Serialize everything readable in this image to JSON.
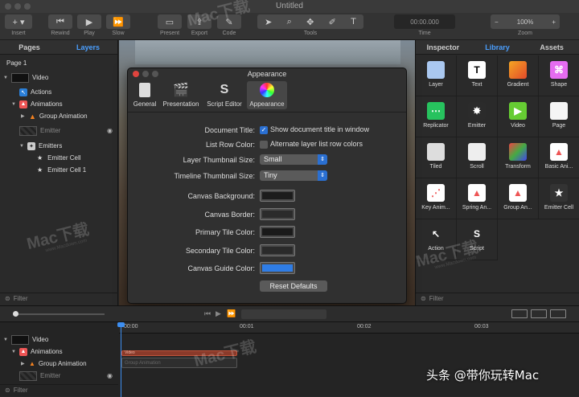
{
  "window": {
    "title": "Untitled"
  },
  "toolbar": {
    "insert": "Insert",
    "rewind": "Rewind",
    "play": "Play",
    "slow": "Slow",
    "present": "Present",
    "export": "Export",
    "code": "Code",
    "tools": "Tools",
    "time_label": "Time",
    "time_value": "00:00.000",
    "zoom_label": "Zoom",
    "zoom_value": "100%"
  },
  "left_panel": {
    "tabs": [
      "Pages",
      "Layers"
    ],
    "page": "Page 1",
    "layers": [
      "Video",
      "Actions",
      "Animations",
      "Group Animation",
      "Emitter",
      "Emitters",
      "Emitter Cell",
      "Emitter Cell 1"
    ],
    "filter": "Filter"
  },
  "right_panel": {
    "tabs": [
      "Inspector",
      "Library",
      "Assets"
    ],
    "items": [
      "Layer",
      "Text",
      "Gradient",
      "Shape",
      "Replicator",
      "Emitter",
      "Video",
      "Page",
      "Tiled",
      "Scroll",
      "Transform",
      "Basic Ani...",
      "Key Anim...",
      "Spring An...",
      "Group An...",
      "Emitter Cell",
      "Action",
      "Script"
    ],
    "filter": "Filter"
  },
  "dialog": {
    "title": "Appearance",
    "tabs": [
      "General",
      "Presentation",
      "Script Editor",
      "Appearance"
    ],
    "document_title_label": "Document Title:",
    "document_title_check": "Show document title in window",
    "list_row_color_label": "List Row Color:",
    "list_row_color_check": "Alternate layer list row colors",
    "layer_thumb_label": "Layer Thumbnail Size:",
    "layer_thumb_value": "Small",
    "timeline_thumb_label": "Timeline Thumbnail Size:",
    "timeline_thumb_value": "Tiny",
    "colors": [
      {
        "label": "Canvas Background:",
        "value": "#1c1c1c"
      },
      {
        "label": "Canvas Border:",
        "value": "#2b2b2b"
      },
      {
        "label": "Primary Tile Color:",
        "value": "#1a1a1a"
      },
      {
        "label": "Secondary Tile Color:",
        "value": "#2a2a2a"
      },
      {
        "label": "Canvas Guide Color:",
        "value": "#2f7de6"
      }
    ],
    "reset": "Reset Defaults"
  },
  "timeline": {
    "ruler": [
      "00:00",
      "00:01",
      "00:02",
      "00:03"
    ],
    "layers": [
      "Video",
      "Animations",
      "Group Animation",
      "Emitter"
    ],
    "clip_video": "Video",
    "clip_group": "Group Animation",
    "filter": "Filter"
  },
  "watermark": {
    "text": "Mac下载",
    "url": "www.Macdown.com",
    "caption": "头条 @带你玩转Mac"
  }
}
